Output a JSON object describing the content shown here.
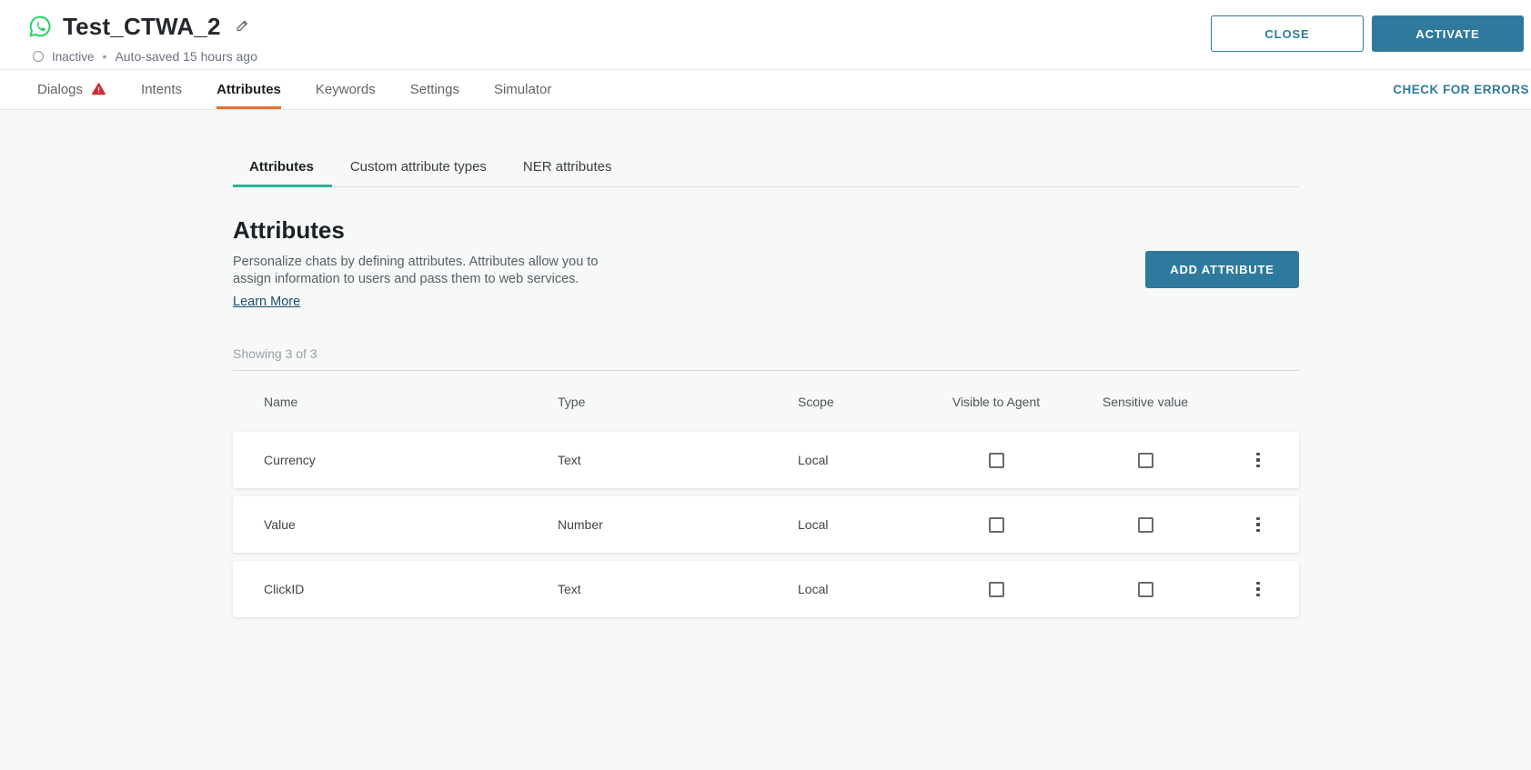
{
  "header": {
    "title": "Test_CTWA_2",
    "status_label": "Inactive",
    "separator": "•",
    "autosave_text": "Auto-saved 15 hours ago",
    "close_label": "CLOSE",
    "activate_label": "ACTIVATE"
  },
  "nav": {
    "tabs": [
      {
        "label": "Dialogs",
        "has_warning": true,
        "active": false
      },
      {
        "label": "Intents",
        "active": false
      },
      {
        "label": "Attributes",
        "active": true
      },
      {
        "label": "Keywords",
        "active": false
      },
      {
        "label": "Settings",
        "active": false
      },
      {
        "label": "Simulator",
        "active": false
      }
    ],
    "check_for_errors_label": "CHECK FOR ERRORS"
  },
  "subtabs": [
    {
      "label": "Attributes",
      "active": true
    },
    {
      "label": "Custom attribute types",
      "active": false
    },
    {
      "label": "NER attributes",
      "active": false
    }
  ],
  "section": {
    "title": "Attributes",
    "description_line1": "Personalize chats by defining attributes. Attributes allow you to",
    "description_line2": "assign information to users and pass them to web services.",
    "learn_more_label": "Learn More",
    "add_button_label": "ADD ATTRIBUTE",
    "showing_text": "Showing 3 of 3"
  },
  "table": {
    "columns": [
      "Name",
      "Type",
      "Scope",
      "Visible to Agent",
      "Sensitive value"
    ],
    "rows": [
      {
        "name": "Currency",
        "type": "Text",
        "scope": "Local",
        "visible_to_agent": false,
        "sensitive_value": false
      },
      {
        "name": "Value",
        "type": "Number",
        "scope": "Local",
        "visible_to_agent": false,
        "sensitive_value": false
      },
      {
        "name": "ClickID",
        "type": "Text",
        "scope": "Local",
        "visible_to_agent": false,
        "sensitive_value": false
      }
    ]
  },
  "colors": {
    "accent_teal": "#2f7a9c",
    "active_tab_orange": "#e8702c",
    "active_subtab_green": "#2db093",
    "whatsapp_green": "#25d366",
    "warning_red": "#d02c2f"
  }
}
